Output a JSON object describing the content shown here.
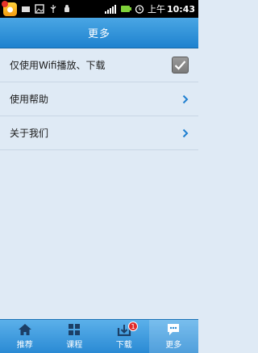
{
  "status_bar": {
    "ampm": "上午",
    "time": "10:43"
  },
  "header": {
    "title": "更多"
  },
  "settings": {
    "items": [
      {
        "label": "仅使用Wifi播放、下载",
        "type": "checkbox",
        "checked": true
      },
      {
        "label": "使用帮助",
        "type": "link"
      },
      {
        "label": "关于我们",
        "type": "link"
      }
    ]
  },
  "tabbar": {
    "tabs": [
      {
        "label": "推荐",
        "icon": "home-icon"
      },
      {
        "label": "课程",
        "icon": "grid-icon"
      },
      {
        "label": "下载",
        "icon": "download-icon",
        "badge": "1"
      },
      {
        "label": "更多",
        "icon": "chat-more-icon",
        "active": true
      }
    ]
  },
  "colors": {
    "header": "#2a8ad4",
    "background": "#dfeaf5",
    "badge": "#e12a2a"
  }
}
